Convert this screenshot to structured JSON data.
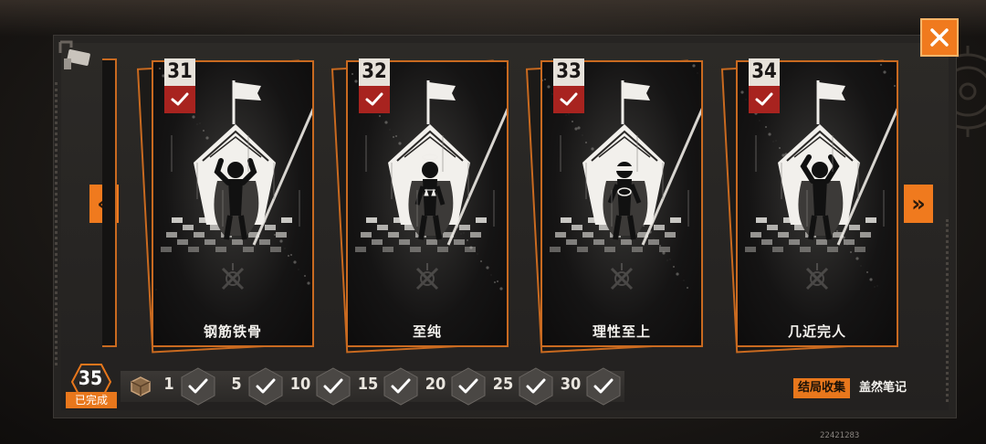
{
  "cards": [
    {
      "number": "31",
      "title": "钢筋铁骨",
      "completed": true,
      "emblem": "muscle-flex"
    },
    {
      "number": "32",
      "title": "至纯",
      "completed": true,
      "emblem": "halo-scales"
    },
    {
      "number": "33",
      "title": "理性至上",
      "completed": true,
      "emblem": "eye-visor"
    },
    {
      "number": "34",
      "title": "几近完人",
      "completed": true,
      "emblem": "arms-raised"
    }
  ],
  "progress": {
    "completed_count": "35",
    "completed_label": "已完成",
    "milestones": [
      {
        "label": "1",
        "claimed": true
      },
      {
        "label": "5",
        "claimed": true
      },
      {
        "label": "10",
        "claimed": true
      },
      {
        "label": "15",
        "claimed": true
      },
      {
        "label": "20",
        "claimed": true
      },
      {
        "label": "25",
        "claimed": true
      },
      {
        "label": "30",
        "claimed": true
      }
    ]
  },
  "footer": {
    "ending_tag": "结局收集",
    "ending_text": "盖然笔记",
    "uid": "22421283"
  },
  "colors": {
    "accent": "#f07a1e",
    "card_border": "#c96a20",
    "check_red": "#a8231f"
  },
  "icons": [
    "close-icon",
    "chevrons-left-icon",
    "chevrons-right-icon",
    "check-icon",
    "box-icon",
    "camera-icon",
    "gear-icon"
  ]
}
